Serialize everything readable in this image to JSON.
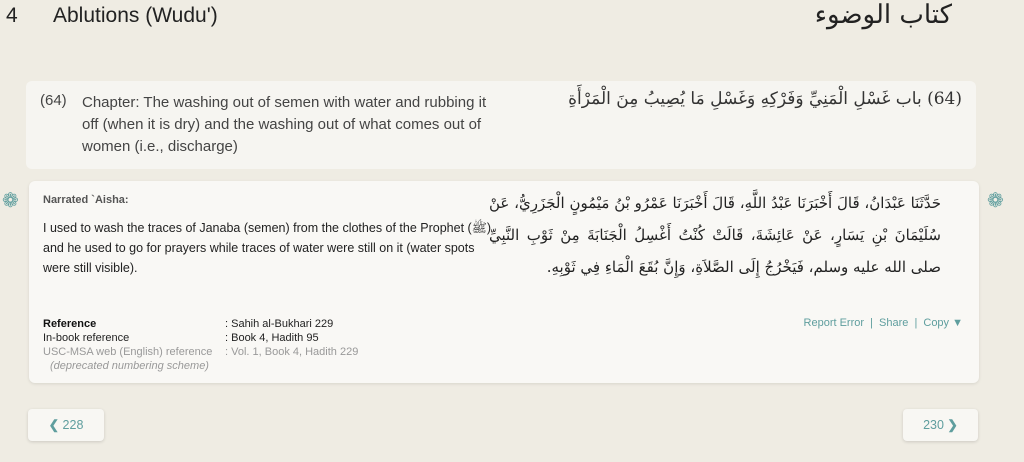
{
  "book": {
    "number": "4",
    "title": "Ablutions (Wudu')",
    "arabic_title": "كتاب الوضوء"
  },
  "chapter": {
    "number": "(64)",
    "english": "Chapter: The washing out of semen with water and rubbing it off (when it is dry) and the washing out of what comes out of women (i.e., discharge)",
    "arabic": "(64) باب غَسْلِ الْمَنِيِّ وَفَرْكِهِ وَغَسْلِ مَا يُصِيبُ مِنَ الْمَرْأَةِ"
  },
  "hadith": {
    "narrator": "Narrated `Aisha:",
    "english": "I used to wash the traces of Janaba (semen) from the clothes of the Prophet (ﷺ) and he used to go for prayers while traces of water were still on it (water spots were still visible).",
    "arabic": "حَدَّثَنَا عَبْدَانُ، قَالَ أَخْبَرَنَا عَبْدُ اللَّهِ، قَالَ أَخْبَرَنَا عَمْرُو بْنُ مَيْمُونٍ الْجَزَرِيُّ، عَنْ سُلَيْمَانَ بْنِ يَسَارٍ، عَنْ عَائِشَةَ، قَالَتْ كُنْتُ أَغْسِلُ الْجَنَابَةَ مِنْ ثَوْبِ النَّبِيِّ صلى الله عليه وسلم، فَيَخْرُجُ إِلَى الصَّلاَةِ، وَإِنَّ بُقَعَ الْمَاءِ فِي ثَوْبِهِ.",
    "references": [
      {
        "label": "Reference",
        "value": ": Sahih al-Bukhari 229"
      },
      {
        "label": "In-book reference",
        "value": ": Book 4, Hadith 95"
      },
      {
        "label": "USC-MSA web (English) reference",
        "value": ": Vol. 1, Book 4, Hadith 229"
      }
    ],
    "deprecated_note": "(deprecated numbering scheme)",
    "actions": {
      "report": "Report Error",
      "share": "Share",
      "copy": "Copy ▼",
      "separator": "|"
    }
  },
  "pagination": {
    "prev_label": "228",
    "next_label": "230",
    "prev_arrow": "❮",
    "next_arrow": "❯"
  },
  "icons": {
    "ornament": "❁",
    "ornament_name": "flower-ornament-icon"
  },
  "colors": {
    "accent": "#5f9e9e",
    "background": "#efece3",
    "card": "#f9f8f5"
  }
}
